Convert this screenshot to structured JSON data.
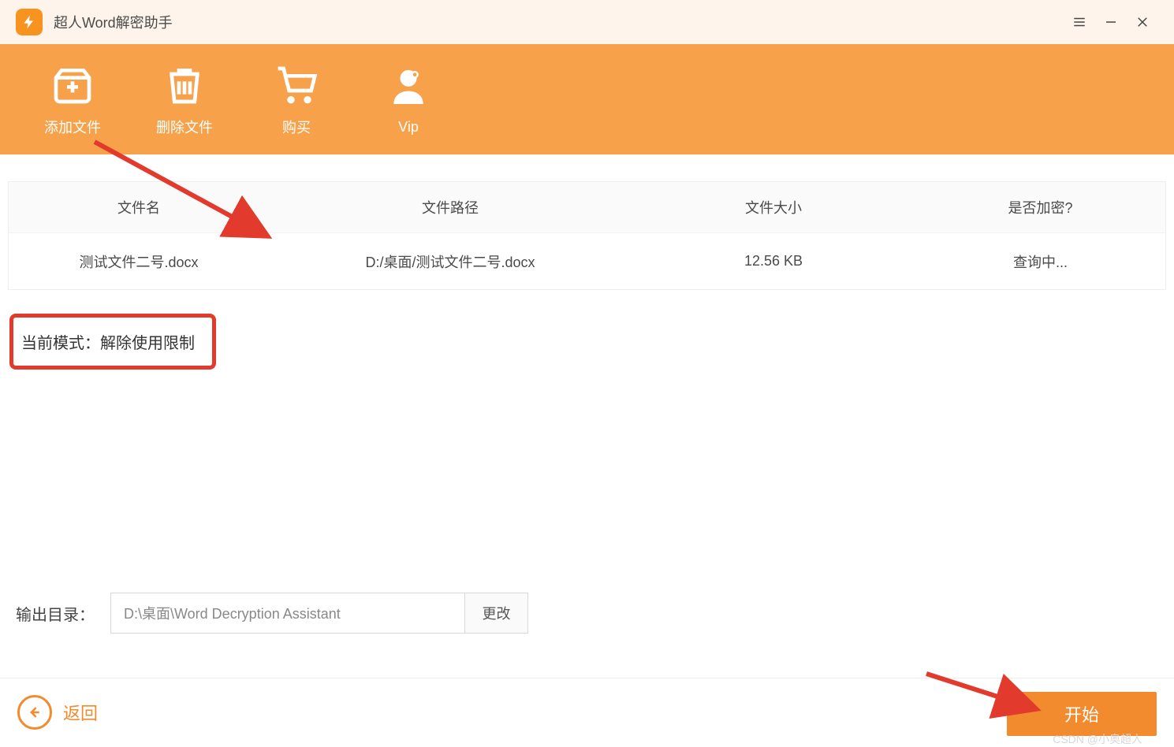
{
  "app": {
    "title": "超人Word解密助手"
  },
  "window_buttons": {
    "menu": "menu",
    "minimize": "minimize",
    "close": "close"
  },
  "toolbar": {
    "add_file": "添加文件",
    "delete_file": "删除文件",
    "buy": "购买",
    "vip": "Vip"
  },
  "table": {
    "headers": {
      "name": "文件名",
      "path": "文件路径",
      "size": "文件大小",
      "encrypted": "是否加密?"
    },
    "rows": [
      {
        "name": "测试文件二号.docx",
        "path": "D:/桌面/测试文件二号.docx",
        "size": "12.56 KB",
        "encrypted": "查询中..."
      }
    ]
  },
  "mode": {
    "label": "当前模式：解除使用限制"
  },
  "output": {
    "label": "输出目录：",
    "path": "D:\\桌面\\Word Decryption Assistant",
    "change": "更改"
  },
  "footer": {
    "back": "返回",
    "start": "开始"
  },
  "watermark": "CSDN @小奥超人"
}
